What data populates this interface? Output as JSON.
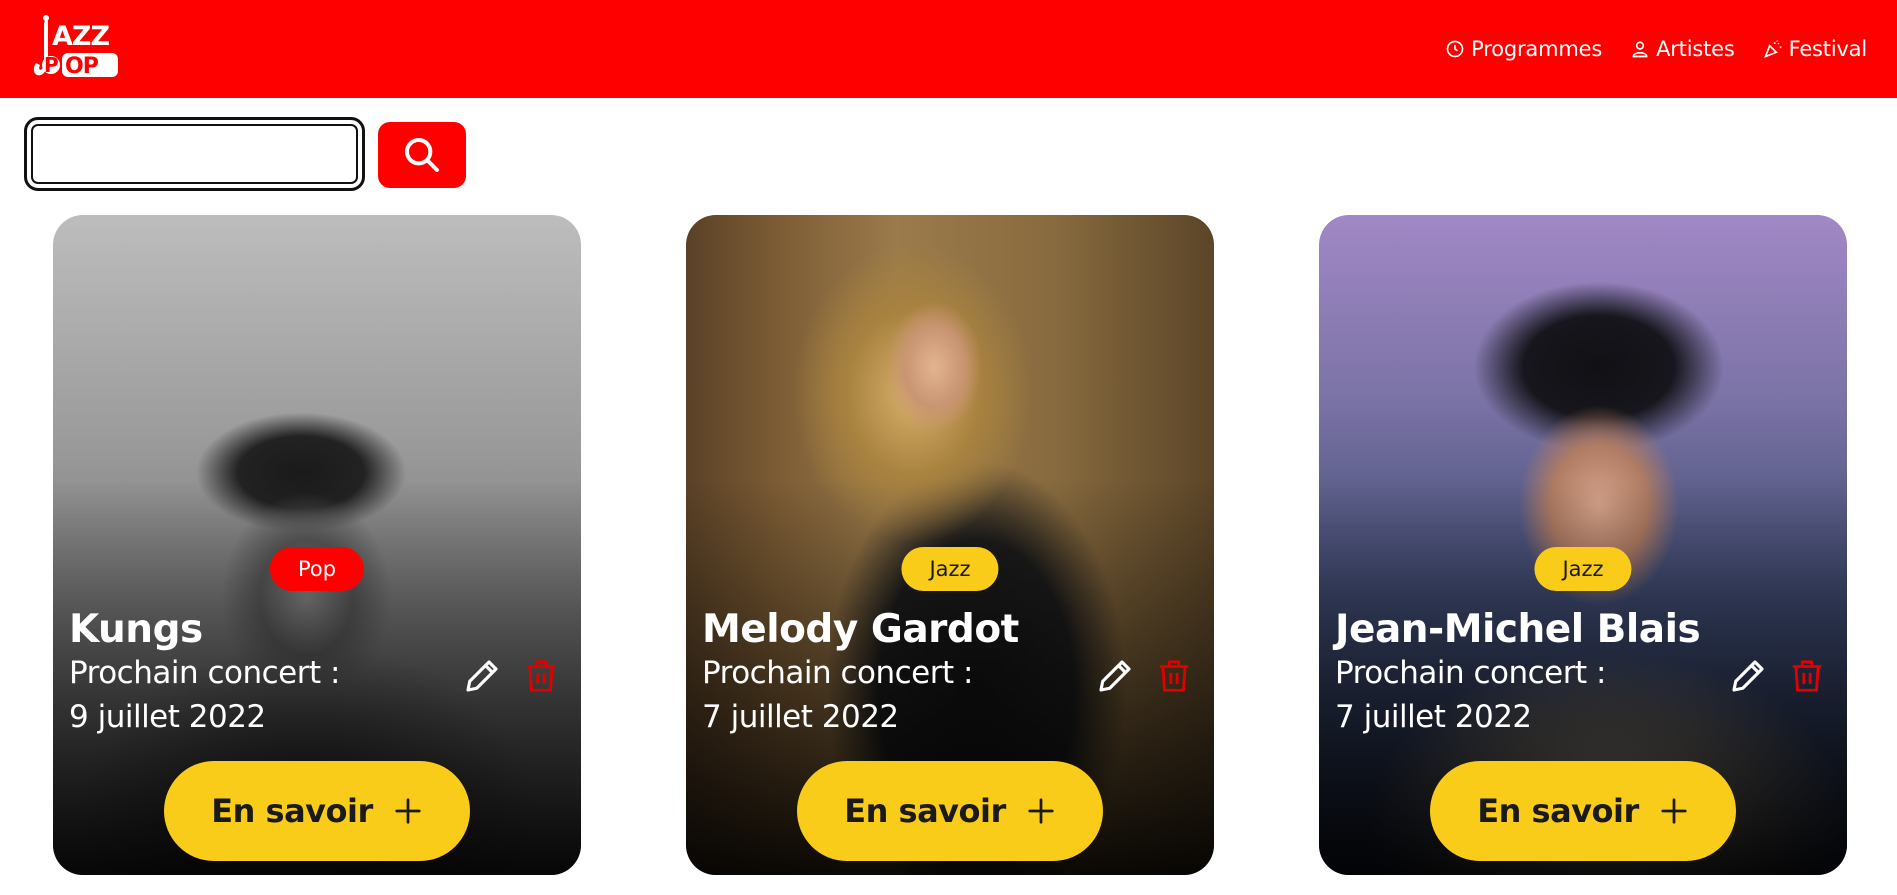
{
  "header": {
    "logo_text": "JAZZ POP",
    "brand_color": "#ff0000",
    "nav": [
      {
        "label": "Programmes",
        "icon": "clock-icon"
      },
      {
        "label": "Artistes",
        "icon": "user-icon"
      },
      {
        "label": "Festival",
        "icon": "party-popper-icon"
      }
    ]
  },
  "search": {
    "value": "",
    "placeholder": "",
    "button_icon": "search-icon"
  },
  "cards": [
    {
      "genre": "Pop",
      "genre_color": "#ff0000",
      "genre_text_color": "#ffffff",
      "name": "Kungs",
      "concert_label": "Prochain concert :",
      "concert_date": "9 juillet 2022",
      "more_label": "En savoir"
    },
    {
      "genre": "Jazz",
      "genre_color": "#f9cc1a",
      "genre_text_color": "#1a1a1a",
      "name": "Melody Gardot",
      "concert_label": "Prochain concert :",
      "concert_date": "7 juillet 2022",
      "more_label": "En savoir"
    },
    {
      "genre": "Jazz",
      "genre_color": "#f9cc1a",
      "genre_text_color": "#1a1a1a",
      "name": "Jean-Michel Blais",
      "concert_label": "Prochain concert :",
      "concert_date": "7 juillet 2022",
      "more_label": "En savoir"
    }
  ],
  "colors": {
    "accent_yellow": "#f9cc1a",
    "delete_red": "#e00000"
  }
}
